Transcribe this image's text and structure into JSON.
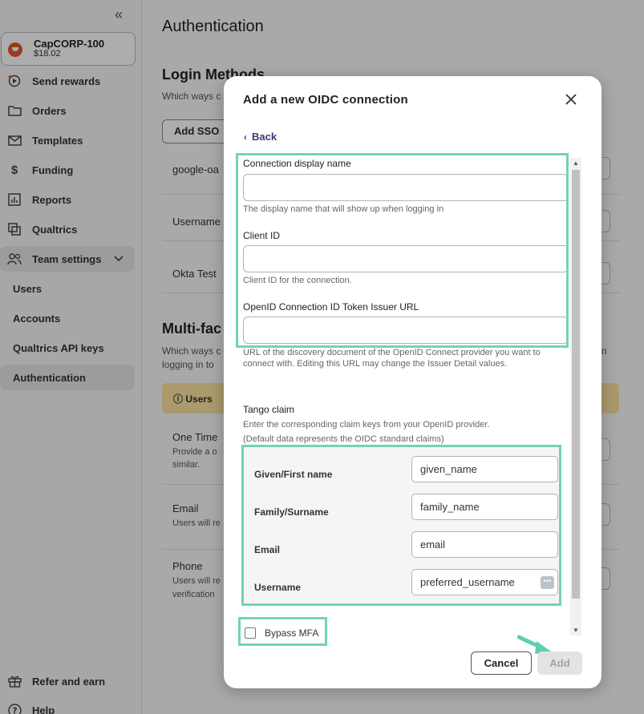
{
  "sidebar": {
    "collapse_icon": "double-chevron-left-icon",
    "account": {
      "name": "CapCORP-100",
      "balance": "$18.02"
    },
    "items": [
      {
        "label": "Send rewards",
        "icon": "send-icon"
      },
      {
        "label": "Orders",
        "icon": "folder-icon"
      },
      {
        "label": "Templates",
        "icon": "envelope-icon"
      },
      {
        "label": "Funding",
        "icon": "dollar-icon"
      },
      {
        "label": "Reports",
        "icon": "bar-chart-icon"
      },
      {
        "label": "Qualtrics",
        "icon": "qualtrics-icon"
      },
      {
        "label": "Team settings",
        "icon": "people-icon"
      },
      {
        "label": "Users"
      },
      {
        "label": "Accounts"
      },
      {
        "label": "Qualtrics API keys"
      },
      {
        "label": "Authentication"
      }
    ],
    "footer": [
      {
        "label": "Refer and earn",
        "icon": "gift-icon"
      },
      {
        "label": "Help",
        "icon": "help-icon"
      }
    ]
  },
  "main": {
    "title": "Authentication",
    "login_methods": {
      "heading": "Login Methods",
      "desc": "Which ways c",
      "add_button": "Add SSO",
      "rows": [
        "google-oa",
        "Username",
        "Okta Test"
      ]
    },
    "mfa": {
      "heading": "Multi-fac",
      "desc_line1": "Which ways c",
      "desc_line2": "logging in to",
      "desc_right": "n",
      "banner": "Users",
      "rows": [
        {
          "title": "One Time",
          "sub1": "Provide a o",
          "sub2": "similar."
        },
        {
          "title": "Email",
          "sub1": "Users will re",
          "sub2": ""
        },
        {
          "title": "Phone",
          "sub1": "Users will re",
          "sub2": "verification"
        }
      ]
    }
  },
  "modal": {
    "title": "Add a new OIDC connection",
    "close_icon": "close-icon",
    "back_label": "Back",
    "fields": [
      {
        "label": "Connection display name",
        "value": "",
        "help": "The display name that will show up when logging in"
      },
      {
        "label": "Client ID",
        "value": "",
        "help": "Client ID for the connection."
      },
      {
        "label": "OpenID Connection ID Token Issuer URL",
        "value": "",
        "help": "URL of the discovery document of the OpenID Connect provider you want to connect with. Editing this URL may change the Issuer Detail values."
      }
    ],
    "tango_claim": {
      "heading": "Tango claim",
      "desc_line1": "Enter the corresponding claim keys from your OpenID provider.",
      "desc_line2": "(Default data represents the OIDC standard claims)",
      "claims": [
        {
          "label": "Given/First name",
          "value": "given_name"
        },
        {
          "label": "Family/Surname",
          "value": "family_name"
        },
        {
          "label": "Email",
          "value": "email"
        },
        {
          "label": "Username",
          "value": "preferred_username"
        }
      ]
    },
    "bypass_mfa": {
      "label": "Bypass MFA",
      "checked": false
    },
    "buttons": {
      "cancel": "Cancel",
      "add": "Add"
    }
  },
  "colors": {
    "highlight": "#73d2b9",
    "back_link": "#3d3a7a",
    "brand": "#e0592a"
  }
}
